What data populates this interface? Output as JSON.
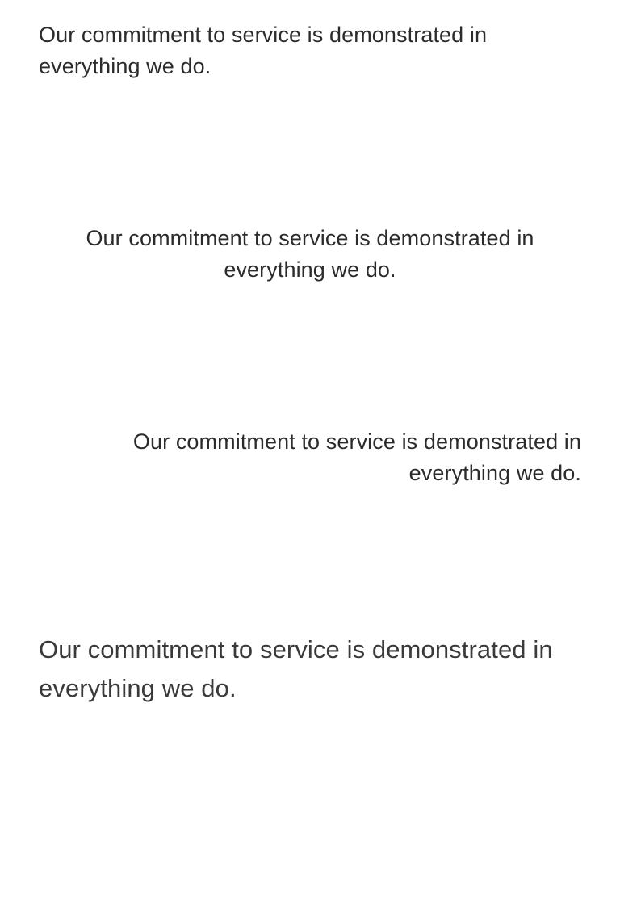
{
  "samples": {
    "left": "Our commitment to service is demonstrated in everything we do.",
    "center": "Our commitment to service is demonstrated in everything we do.",
    "right": "Our commitment to service is demonstrated in everything we do.",
    "large": "Our commitment to service is demonstrated in everything we do."
  },
  "colors": {
    "text": "#2b2b2b",
    "background": "#ffffff"
  }
}
